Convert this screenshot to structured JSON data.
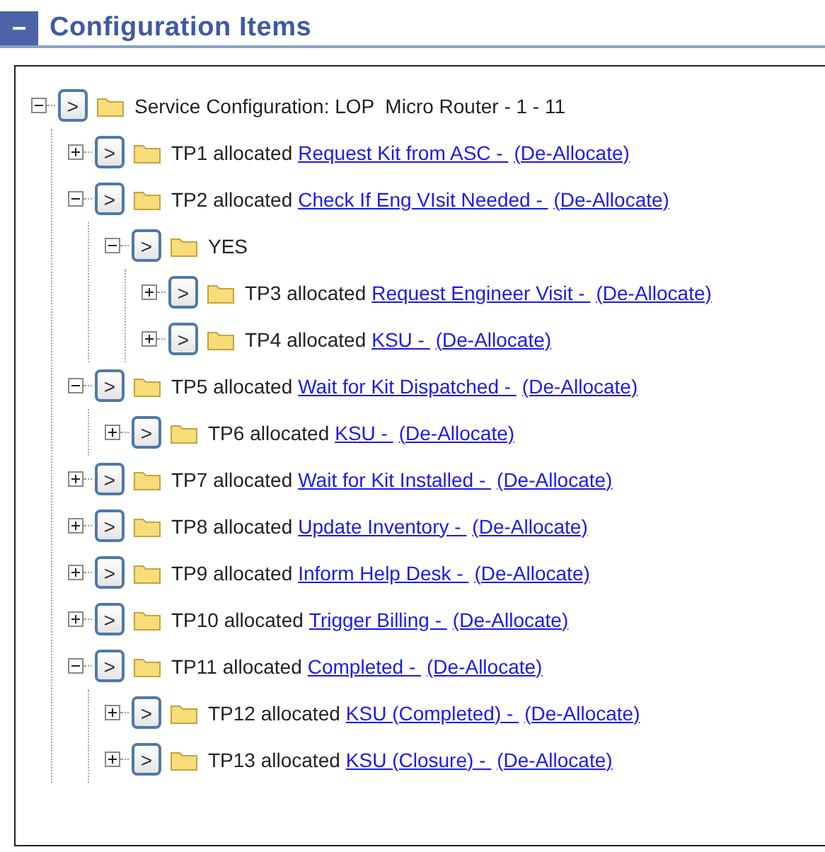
{
  "header": {
    "collapse_label": "−",
    "title": "Configuration Items"
  },
  "tree": [
    {
      "expanded": true,
      "go": ">",
      "label": "Service Configuration: LOP  Micro Router - 1 - 11",
      "children": [
        {
          "expanded": false,
          "go": ">",
          "label": "TP1 allocated",
          "link": "Request Kit from ASC - ",
          "action": "(De-Allocate)"
        },
        {
          "expanded": true,
          "go": ">",
          "label": "TP2 allocated",
          "link": "Check If Eng VIsit Needed - ",
          "action": "(De-Allocate)",
          "children": [
            {
              "expanded": true,
              "go": ">",
              "label": "YES",
              "children": [
                {
                  "expanded": false,
                  "go": ">",
                  "label": "TP3 allocated",
                  "link": "Request Engineer Visit - ",
                  "action": "(De-Allocate)"
                },
                {
                  "expanded": false,
                  "go": ">",
                  "label": "TP4 allocated",
                  "link": "KSU - ",
                  "action": "(De-Allocate)"
                }
              ]
            }
          ]
        },
        {
          "expanded": true,
          "go": ">",
          "label": "TP5 allocated",
          "link": "Wait for Kit Dispatched - ",
          "action": "(De-Allocate)",
          "children": [
            {
              "expanded": false,
              "go": ">",
              "label": "TP6 allocated",
              "link": "KSU - ",
              "action": "(De-Allocate)"
            }
          ]
        },
        {
          "expanded": false,
          "go": ">",
          "label": "TP7 allocated",
          "link": "Wait for Kit Installed - ",
          "action": "(De-Allocate)"
        },
        {
          "expanded": false,
          "go": ">",
          "label": "TP8 allocated",
          "link": "Update Inventory - ",
          "action": "(De-Allocate)"
        },
        {
          "expanded": false,
          "go": ">",
          "label": "TP9 allocated",
          "link": "Inform Help Desk - ",
          "action": "(De-Allocate)"
        },
        {
          "expanded": false,
          "go": ">",
          "label": "TP10 allocated",
          "link": "Trigger Billing - ",
          "action": "(De-Allocate)"
        },
        {
          "expanded": true,
          "go": ">",
          "label": "TP11 allocated",
          "link": "Completed - ",
          "action": "(De-Allocate)",
          "children": [
            {
              "expanded": false,
              "go": ">",
              "label": "TP12 allocated",
              "link": "KSU (Completed) - ",
              "action": "(De-Allocate)"
            },
            {
              "expanded": false,
              "go": ">",
              "label": "TP13 allocated",
              "link": "KSU (Closure) - ",
              "action": "(De-Allocate)"
            }
          ]
        }
      ]
    }
  ]
}
